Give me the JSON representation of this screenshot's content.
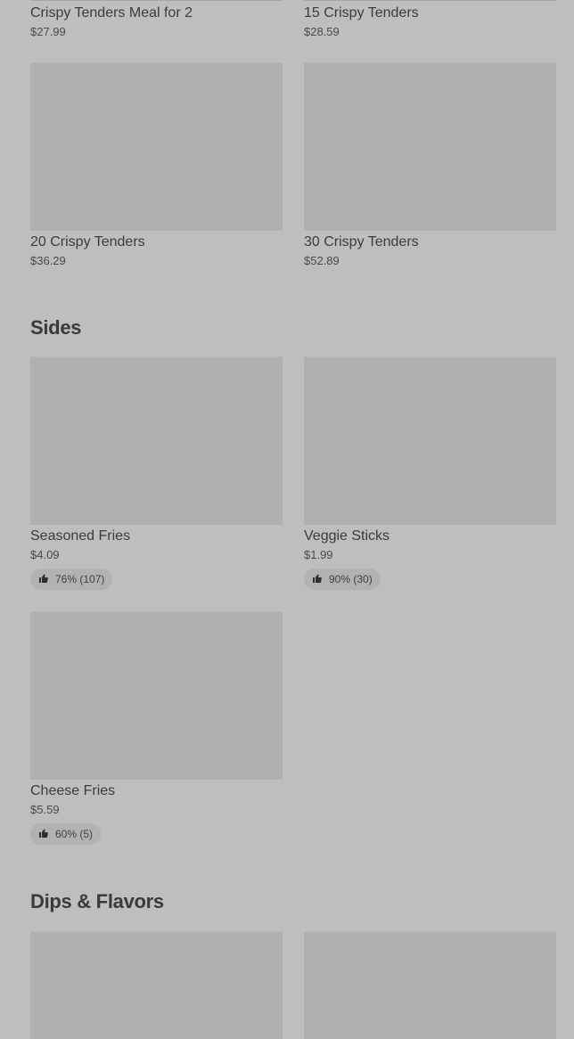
{
  "top_items": [
    {
      "title": "Crispy Tenders Meal for 2",
      "price": "$27.99"
    },
    {
      "title": "15 Crispy Tenders",
      "price": "$28.59"
    }
  ],
  "tenders_items": [
    {
      "title": "20 Crispy Tenders",
      "price": "$36.29"
    },
    {
      "title": "30 Crispy Tenders",
      "price": "$52.89"
    }
  ],
  "sides": {
    "heading": "Sides",
    "items": [
      {
        "title": "Seasoned Fries",
        "price": "$4.09",
        "rating": "76% (107)"
      },
      {
        "title": "Veggie Sticks",
        "price": "$1.99",
        "rating": "90% (30)"
      },
      {
        "title": "Cheese Fries",
        "price": "$5.59",
        "rating": "60% (5)"
      }
    ]
  },
  "dips": {
    "heading": "Dips & Flavors"
  },
  "icons": {
    "rating": "thumbs-up-icon"
  }
}
